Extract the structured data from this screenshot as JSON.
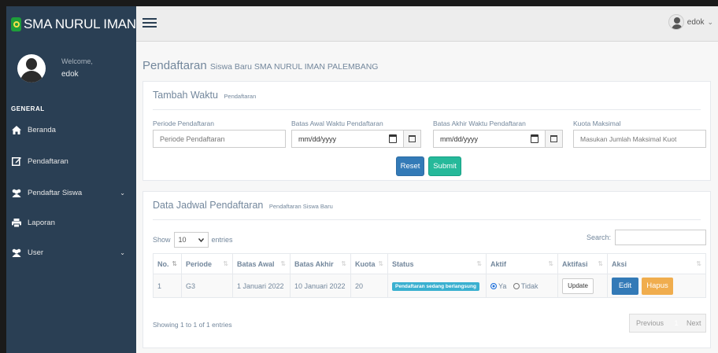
{
  "app": {
    "title": "SMA NURUL IMAN",
    "user": "edok",
    "user_caret": "⌄"
  },
  "sidebar": {
    "welcome": "Welcome,",
    "name": "edok",
    "section": "GENERAL",
    "items": [
      {
        "label": "Beranda",
        "icon": "home-icon"
      },
      {
        "label": "Pendaftaran",
        "icon": "edit-icon"
      },
      {
        "label": "Pendaftar Siswa",
        "icon": "users-icon",
        "caret": "⌄"
      },
      {
        "label": "Laporan",
        "icon": "print-icon"
      },
      {
        "label": "User",
        "icon": "users-icon",
        "caret": "⌄"
      }
    ]
  },
  "page": {
    "title": "Pendaftaran",
    "subtitle": "Siswa Baru SMA NURUL IMAN PALEMBANG"
  },
  "form_panel": {
    "title": "Tambah Waktu",
    "subtitle": "Pendaftaran",
    "fields": {
      "periode_label": "Periode Pendaftaran",
      "periode_placeholder": "Periode Pendaftaran",
      "awal_label": "Batas Awal Waktu Pendaftaran",
      "awal_value": "mm/dd/yyyy",
      "akhir_label": "Batas Akhir Waktu Pendaftaran",
      "akhir_value": "mm/dd/yyyy",
      "kuota_label": "Kuota Maksimal",
      "kuota_placeholder": "Masukan Jumlah Maksimal Kuot"
    },
    "reset_label": "Reset",
    "submit_label": "Submit"
  },
  "table_panel": {
    "title": "Data Jadwal Pendaftaran",
    "subtitle": "Pendaftaran Siswa Baru",
    "show": "Show",
    "entries_value": "10",
    "entries": "entries",
    "search_label": "Search:",
    "columns": [
      "No.",
      "Periode",
      "Batas Awal",
      "Batas Akhir",
      "Kuota",
      "Status",
      "Aktif",
      "Aktifasi",
      "Aksi"
    ],
    "rows": [
      {
        "no": "1",
        "periode": "G3",
        "awal": "1 Januari 2022",
        "akhir": "10 Januari 2022",
        "kuota": "20",
        "status": "Pendaftaran sedang berlangsung",
        "aktif_ya": "Ya",
        "aktif_tidak": "Tidak",
        "aktif_selected": "Ya",
        "update": "Update",
        "edit": "Edit",
        "hapus": "Hapus"
      }
    ],
    "info": "Showing 1 to 1 of 1 entries",
    "pager": {
      "previous": "Previous",
      "current": "1",
      "next": "Next"
    }
  },
  "colors": {
    "sidebar": "#2a3f54",
    "primary": "#337ab7",
    "success": "#26b99a",
    "warning": "#f0ad4e",
    "info": "#3ab0d0"
  }
}
